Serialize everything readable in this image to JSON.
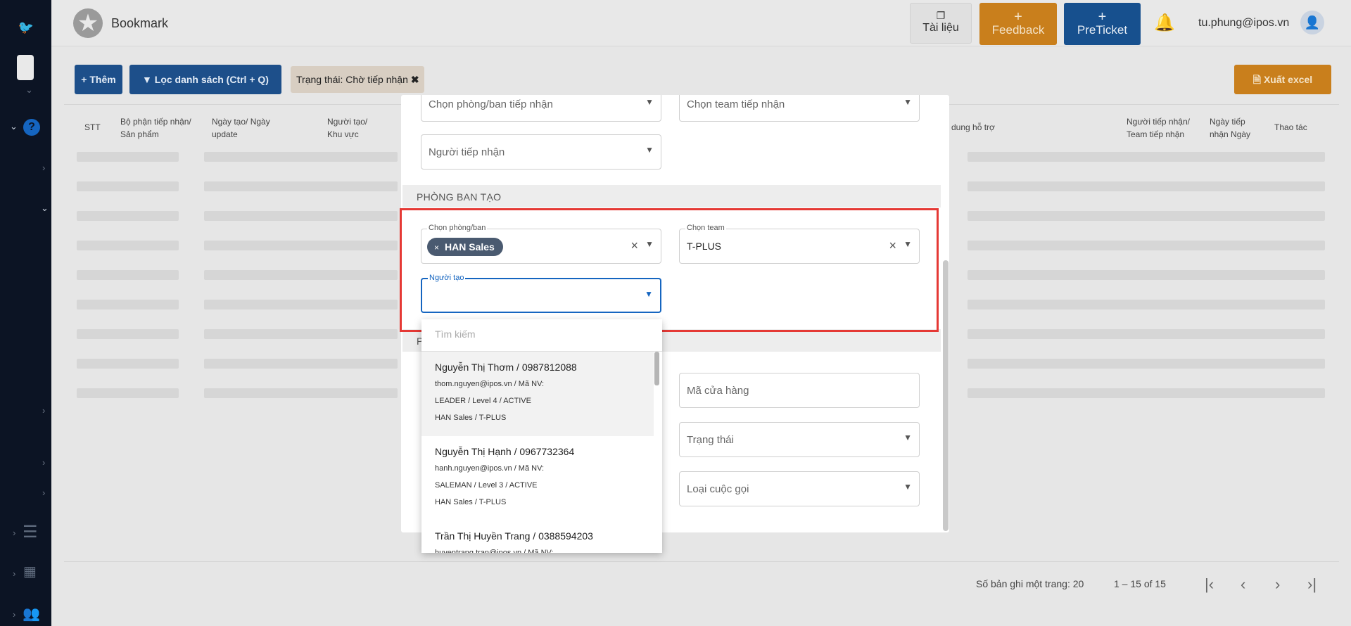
{
  "app": {
    "title": "Bookmark",
    "logo_icon": "bird-logo-icon",
    "user_email": "tu.phung@ipos.vn"
  },
  "topbar": {
    "tailieu_label": "Tài liệu",
    "feedback_plus": "+",
    "feedback_label": "Feedback",
    "preticket_plus": "+",
    "preticket_label": "PreTicket"
  },
  "toolbar": {
    "them_label": "+ Thêm",
    "loc_label": "Lọc danh sách (Ctrl + Q)",
    "status_chip": "Trạng thái: Chờ tiếp nhận",
    "status_chip_close": "✖",
    "excel_label": "Xuất excel"
  },
  "table": {
    "headers": [
      "STT",
      "Bộ phận tiếp nhận/ Sản phẩm",
      "Ngày tạo/ Ngày update",
      "Người tạo/ Khu vực",
      "dung hỗ trợ",
      "Người tiếp nhận/ Team tiếp nhận",
      "Ngày tiếp nhận Ngày hoàn thà",
      "Thao tác"
    ]
  },
  "footer": {
    "page_size": "Số bản ghi một trang: 20",
    "range": "1 – 15 of 15"
  },
  "modal": {
    "phong_ban_tiep_nhan_placeholder": "Chọn phòng/ban tiếp nhận",
    "team_tiep_nhan_placeholder": "Chọn team tiếp nhận",
    "nguoi_tiep_nhan_placeholder": "Người tiếp nhận",
    "section_phong_ban_tao": "PHÒNG BAN TẠO",
    "phong_ban_label": "Chọn phòng/ban",
    "phong_ban_pill": "HAN Sales",
    "pill_remove": "×",
    "team_label": "Chọn team",
    "team_value": "T-PLUS",
    "nguoi_tao_label": "Người tạo",
    "section_second_letter": "P",
    "ma_cua_hang_placeholder": "Mã cửa hàng",
    "trang_thai_placeholder": "Trạng thái",
    "loai_cuoc_goi_placeholder": "Loại cuộc gọi"
  },
  "dropdown": {
    "search_placeholder": "Tìm kiếm",
    "items": [
      {
        "name": "Nguyễn Thị Thơm / 0987812088",
        "line1": "thom.nguyen@ipos.vn / Mã NV:",
        "line2": "LEADER / Level 4 / ACTIVE",
        "line3": "HAN Sales / T-PLUS"
      },
      {
        "name": "Nguyễn Thị Hạnh / 0967732364",
        "line1": "hanh.nguyen@ipos.vn / Mã NV:",
        "line2": "SALEMAN / Level 3 / ACTIVE",
        "line3": "HAN Sales / T-PLUS"
      },
      {
        "name": "Trần Thị Huyền Trang / 0388594203",
        "line1": "huyentrang.tran@ipos.vn / Mã NV:",
        "line2": "",
        "line3": ""
      }
    ]
  },
  "colors": {
    "sidebar": "#0c1424",
    "primary": "#1d4f8a",
    "accent_orange": "#c97f1c",
    "highlight_red": "#e53935",
    "focus_blue": "#1565c0"
  }
}
